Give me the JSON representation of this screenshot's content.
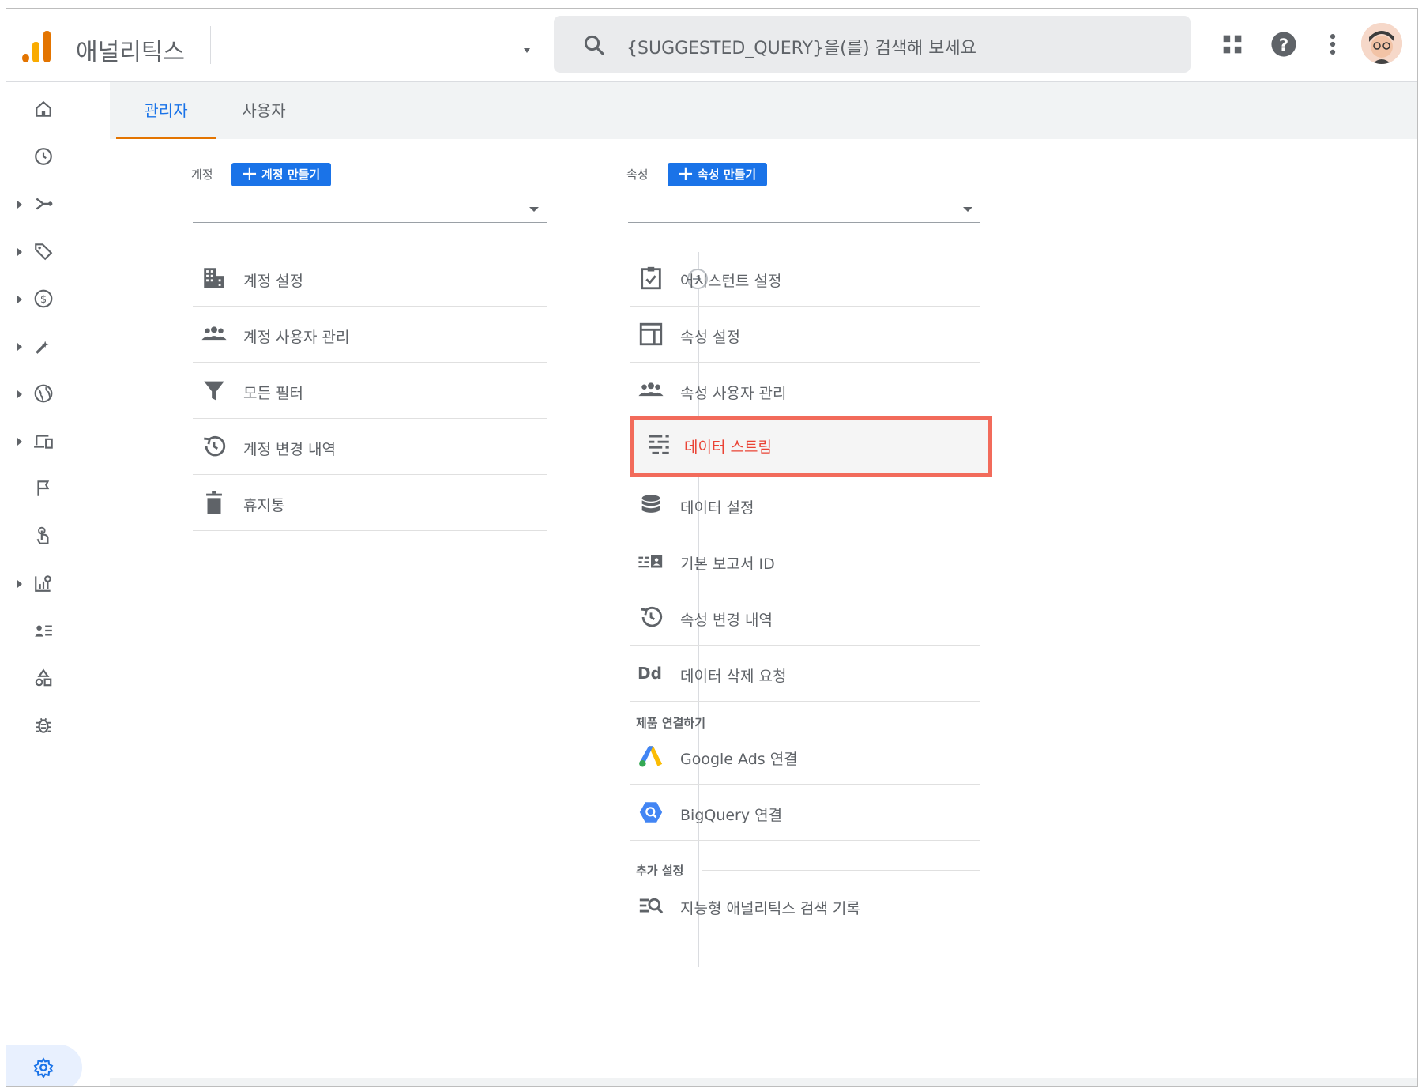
{
  "header": {
    "app_title": "애널리틱스",
    "search_placeholder": "{SUGGESTED_QUERY}을(를) 검색해 보세요",
    "icons": [
      "apps-grid-icon",
      "help-icon",
      "more-vert-icon",
      "avatar"
    ]
  },
  "tabs": [
    {
      "label": "관리자",
      "active": true
    },
    {
      "label": "사용자",
      "active": false
    }
  ],
  "account_column": {
    "heading": "계정",
    "create_button": "계정 만들기",
    "selected_value": "",
    "items": [
      {
        "label": "계정 설정",
        "icon": "building-icon"
      },
      {
        "label": "계정 사용자 관리",
        "icon": "people-icon"
      },
      {
        "label": "모든 필터",
        "icon": "filter-icon"
      },
      {
        "label": "계정 변경 내역",
        "icon": "history-icon"
      },
      {
        "label": "휴지통",
        "icon": "trash-icon"
      }
    ]
  },
  "property_column": {
    "heading": "속성",
    "create_button": "속성 만들기",
    "selected_value": "",
    "items": [
      {
        "label": "어시스턴트 설정",
        "icon": "checklist-icon"
      },
      {
        "label": "속성 설정",
        "icon": "layout-icon"
      },
      {
        "label": "속성 사용자 관리",
        "icon": "people-icon"
      },
      {
        "label": "데이터 스트림",
        "icon": "streams-icon",
        "highlighted": true
      },
      {
        "label": "데이터 설정",
        "icon": "database-icon"
      },
      {
        "label": "기본 보고서 ID",
        "icon": "report-id-icon"
      },
      {
        "label": "속성 변경 내역",
        "icon": "history-icon"
      },
      {
        "label": "데이터 삭제 요청",
        "icon": "dd-icon",
        "icon_text": "Dd"
      }
    ],
    "product_links_heading": "제품 연결하기",
    "product_links": [
      {
        "label": "Google Ads 연결",
        "icon": "google-ads-icon"
      },
      {
        "label": "BigQuery 연결",
        "icon": "bigquery-icon"
      }
    ],
    "additional_heading": "추가 설정",
    "additional_items": [
      {
        "label": "지능형 애널리틱스 검색 기록",
        "icon": "search-history-icon"
      }
    ]
  },
  "left_nav": [
    {
      "icon": "home-icon",
      "expandable": false
    },
    {
      "icon": "realtime-clock-icon",
      "expandable": false
    },
    {
      "icon": "acquisition-icon",
      "expandable": true
    },
    {
      "icon": "tag-icon",
      "expandable": true
    },
    {
      "icon": "monetization-icon",
      "expandable": true
    },
    {
      "icon": "engagement-icon",
      "expandable": true
    },
    {
      "icon": "globe-icon",
      "expandable": true
    },
    {
      "icon": "devices-icon",
      "expandable": true
    },
    {
      "icon": "flag-icon",
      "expandable": false
    },
    {
      "icon": "touch-icon",
      "expandable": false
    },
    {
      "icon": "analysis-icon",
      "expandable": true
    },
    {
      "icon": "audience-icon",
      "expandable": false
    },
    {
      "icon": "shapes-icon",
      "expandable": false
    },
    {
      "icon": "debug-bug-icon",
      "expandable": false
    },
    {
      "icon": "admin-gear-icon",
      "expandable": false,
      "active": true
    }
  ],
  "colors": {
    "accent_blue": "#1a73e8",
    "tab_underline": "#e37400",
    "highlight_border": "#f26b5b",
    "highlight_text": "#ea4335"
  }
}
